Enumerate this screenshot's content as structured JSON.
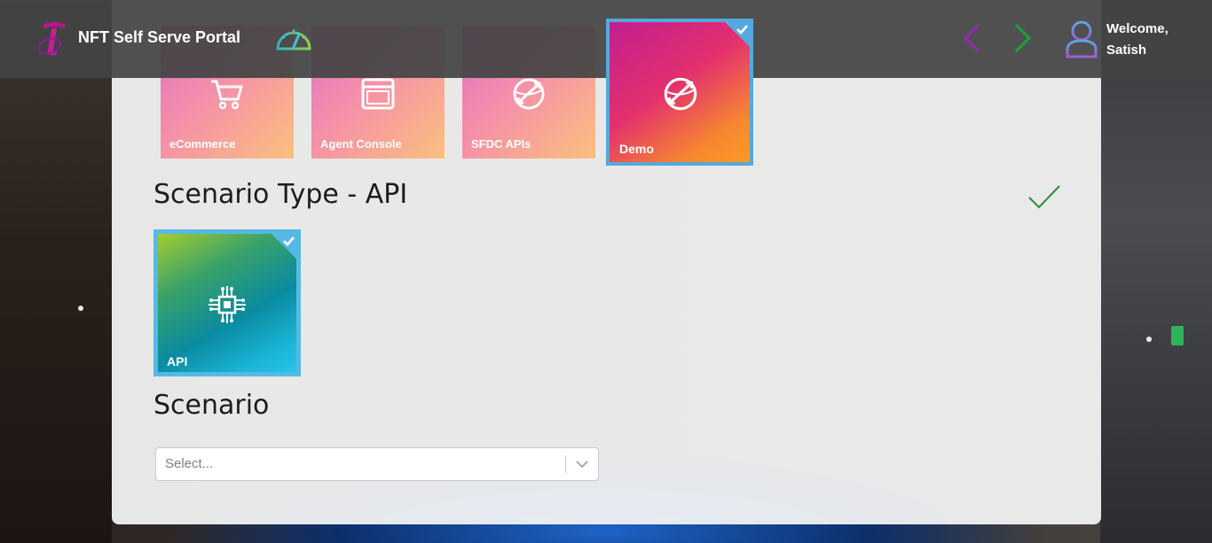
{
  "header": {
    "brand": "NFT Self Serve Portal",
    "welcome_line1": "Welcome,",
    "welcome_line2": "Satish"
  },
  "apps": [
    {
      "label": "eCommerce",
      "icon": "cart-icon"
    },
    {
      "label": "Agent Console",
      "icon": "window-icon"
    },
    {
      "label": "SFDC APIs",
      "icon": "globe-arrows-icon"
    },
    {
      "label": "Demo",
      "icon": "globe-arrows-icon",
      "selected": true
    }
  ],
  "scenario_type": {
    "title": "Scenario Type - API",
    "tile_label": "API",
    "tile_icon": "circuit-chip-icon"
  },
  "scenario": {
    "title": "Scenario",
    "placeholder": "Select..."
  },
  "colors": {
    "accent_blue": "#55a9dc",
    "nav_prev": "#8b2fa8",
    "nav_next": "#1f9a3a",
    "check_green": "#2e8b3a"
  }
}
